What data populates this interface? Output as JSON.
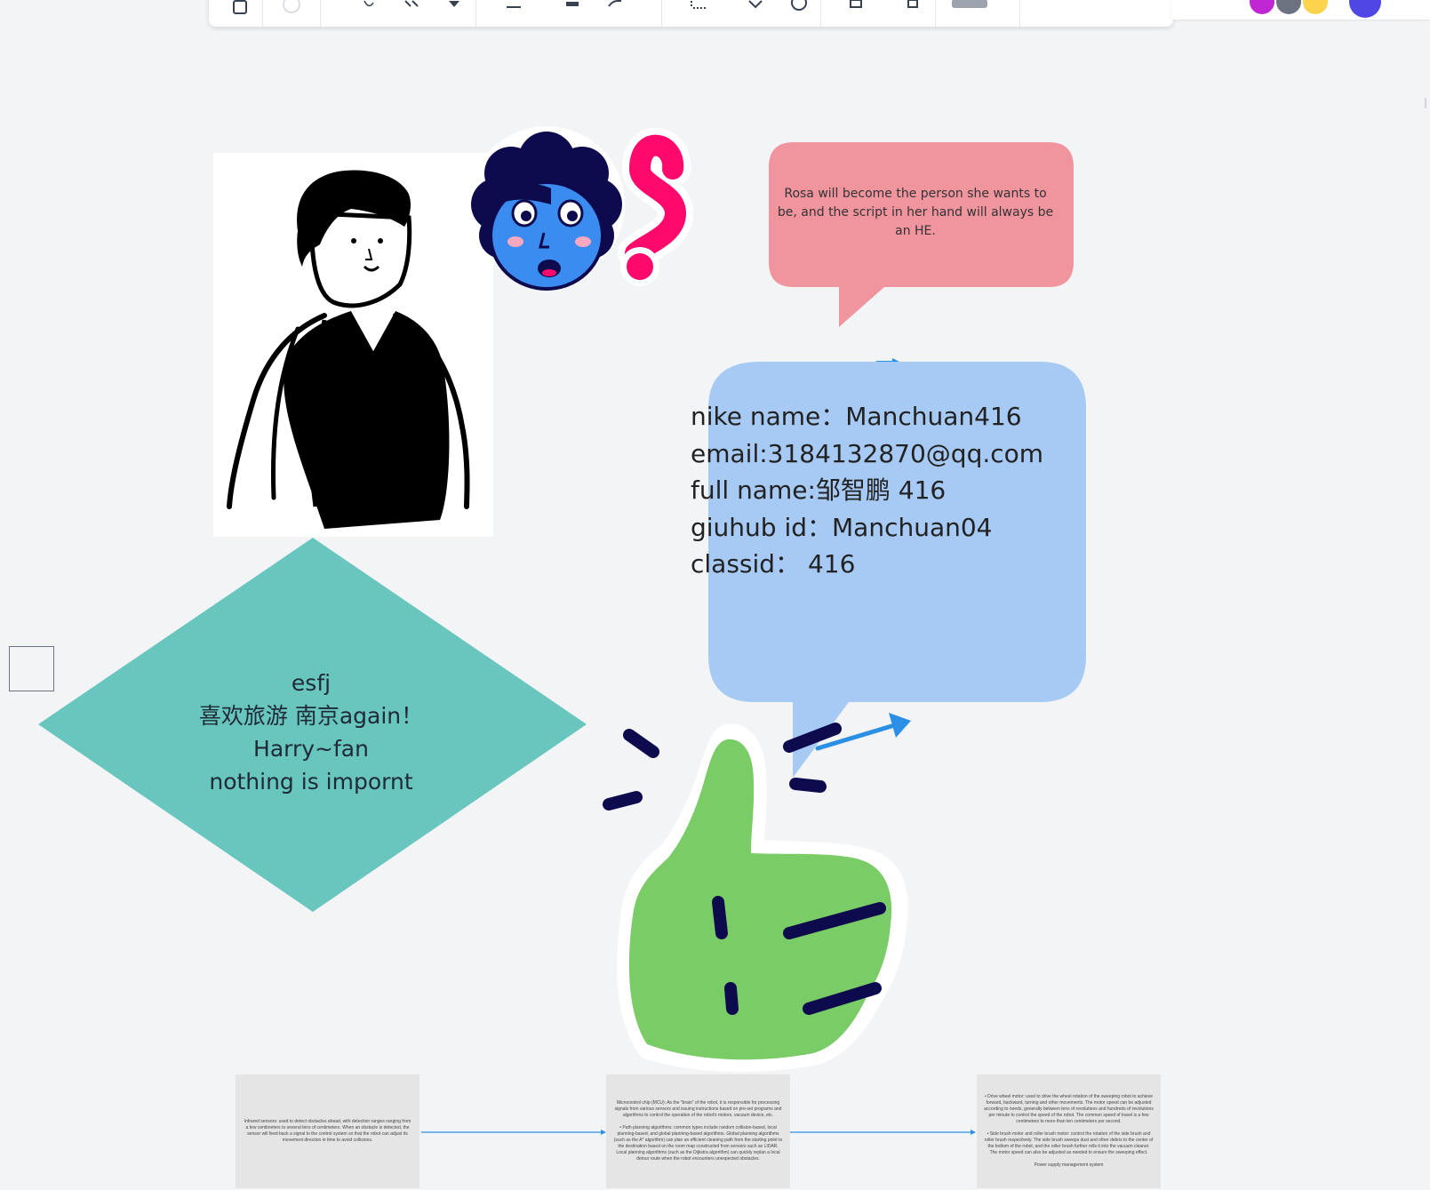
{
  "canvas": {
    "pink_bubble": {
      "text": "Rosa will become the person she wants to be, and the script in her hand will always be an HE."
    },
    "profile_bubble": {
      "lines": [
        "nike name：Manchuan416",
        "email:3184132870@qq.com",
        "full name:邹智鹏 416",
        "giuhub id：Manchuan04",
        "classid： 416"
      ]
    },
    "diamond": {
      "lines": [
        "esfj",
        "喜欢旅游 南京again！",
        "Harry~fan",
        "nothing is impornt"
      ]
    },
    "doc_cards": [
      {
        "text": "Infrared sensors: used to detect obstacles ahead, with detection ranges ranging from a few centimeters to several tens of centimeters. When an obstacle is detected, the sensor will feed back a signal to the control system so that the robot can adjust its movement direction in time to avoid collisions."
      },
      {
        "text": "Microcontrol chip (MCU): As the \"brain\" of the robot, it is responsible for processing signals from various sensors and issuing instructions based on pre-set programs and algorithms to control the operation of the robot's motors, vacuum device, etc.\n\n• Path planning algorithms: common types include random collision-based, local planning-based, and global planning-based algorithms. Global planning algorithms (such as the A* algorithm) can plan an efficient cleaning path from the starting point to the destination based on the room map constructed from sensors such as LIDAR. Local planning algorithms (such as the Dijkstra algorithm) can quickly replan a local detour route when the robot encounters unexpected obstacles."
      },
      {
        "text": "• Drive wheel motor: used to drive the wheel rotation of the sweeping robot to achieve forward, backward, turning and other movements. The motor speed can be adjusted according to needs, generally between tens of revolutions and hundreds of revolutions per minute to control the speed of the robot. The common speed of travel is a few centimeters to more than ten centimeters per second.\n\n• Side brush motor and roller brush motor: control the rotation of the side brush and roller brush respectively. The side brush sweeps dust and other debris to the center of the bottom of the robot, and the roller brush further rolls it into the vacuum cleaner. The motor speed can also be adjusted as needed to ensure the sweeping effect.\n\nPower supply management system"
      }
    ]
  },
  "colors": {
    "canvas_bg": "#f3f4f6",
    "pink_bubble": "#f0959e",
    "blue_bubble": "#a7caf5",
    "diamond": "#68c6bf",
    "thumb_green": "#7acc66",
    "question_mark": "#ff0a6c",
    "face_blue": "#3b8cf0",
    "hair_navy": "#0d0b4d",
    "arrow_blue": "#2b8fe6"
  },
  "icons": [
    "note-icon",
    "circle-icon",
    "text-icon",
    "pen-icon",
    "marker-icon",
    "line-icon",
    "rect-icon",
    "connector-icon",
    "dotted-line-icon",
    "shape-icon",
    "clock-icon",
    "copy-icon",
    "delete-icon",
    "more-icon"
  ]
}
